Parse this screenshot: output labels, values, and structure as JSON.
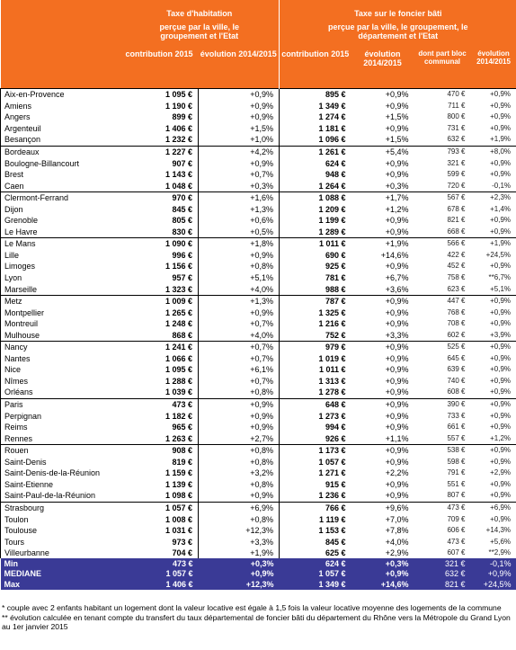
{
  "header": {
    "th_title": "Taxe d'habitation",
    "tf_title": "Taxe sur le foncier bâti",
    "th_sub": "perçue par la ville, le groupement et l'Etat",
    "tf_sub": "perçue par la ville, le groupement, le département et l'Etat",
    "columns": [
      "contribution 2015",
      "évolution 2014/2015",
      "contribution 2015",
      "évolution 2014/2015",
      "dont part bloc communal",
      "évolution 2014/2015"
    ]
  },
  "groups": [
    [
      [
        "Aix-en-Provence",
        "1 095 €",
        "+0,9%",
        "895 €",
        "+0,9%",
        "470 €",
        "+0,9%"
      ],
      [
        "Amiens",
        "1 190 €",
        "+0,9%",
        "1 349 €",
        "+0,9%",
        "711 €",
        "+0,9%"
      ],
      [
        "Angers",
        "899 €",
        "+0,9%",
        "1 274 €",
        "+1,5%",
        "800 €",
        "+0,9%"
      ],
      [
        "Argenteuil",
        "1 406 €",
        "+1,5%",
        "1 181 €",
        "+0,9%",
        "731 €",
        "+0,9%"
      ],
      [
        "Besançon",
        "1 232 €",
        "+1,0%",
        "1 096 €",
        "+1,5%",
        "632 €",
        "+1,9%"
      ]
    ],
    [
      [
        "Bordeaux",
        "1 227 €",
        "+4,2%",
        "1 261 €",
        "+5,4%",
        "793 €",
        "+8,0%"
      ],
      [
        "Boulogne-Billancourt",
        "907 €",
        "+0,9%",
        "624 €",
        "+0,9%",
        "321 €",
        "+0,9%"
      ],
      [
        "Brest",
        "1 143 €",
        "+0,7%",
        "948 €",
        "+0,9%",
        "599 €",
        "+0,9%"
      ],
      [
        "Caen",
        "1 048 €",
        "+0,3%",
        "1 264 €",
        "+0,3%",
        "720 €",
        "-0,1%"
      ]
    ],
    [
      [
        "Clermont-Ferrand",
        "970 €",
        "+1,6%",
        "1 088 €",
        "+1,7%",
        "567 €",
        "+2,3%"
      ],
      [
        "Dijon",
        "845 €",
        "+1,3%",
        "1 209 €",
        "+1,2%",
        "678 €",
        "+1,4%"
      ],
      [
        "Grenoble",
        "805 €",
        "+0,6%",
        "1 199 €",
        "+0,9%",
        "821 €",
        "+0,9%"
      ],
      [
        "Le Havre",
        "830 €",
        "+0,5%",
        "1 289 €",
        "+0,9%",
        "668 €",
        "+0,9%"
      ]
    ],
    [
      [
        "Le Mans",
        "1 090 €",
        "+1,8%",
        "1 011 €",
        "+1,9%",
        "566 €",
        "+1,9%"
      ],
      [
        "Lille",
        "996 €",
        "+0,9%",
        "690 €",
        "+14,6%",
        "422 €",
        "+24,5%"
      ],
      [
        "Limoges",
        "1 156 €",
        "+0,8%",
        "925 €",
        "+0,9%",
        "452 €",
        "+0,9%"
      ],
      [
        "Lyon",
        "957 €",
        "+5,1%",
        "781 €",
        "+6,7%",
        "758 €",
        "**6,7%"
      ],
      [
        "Marseille",
        "1 323 €",
        "+4,0%",
        "988 €",
        "+3,6%",
        "623 €",
        "+5,1%"
      ]
    ],
    [
      [
        "Metz",
        "1 009 €",
        "+1,3%",
        "787 €",
        "+0,9%",
        "447 €",
        "+0,9%"
      ],
      [
        "Montpellier",
        "1 265 €",
        "+0,9%",
        "1 325 €",
        "+0,9%",
        "768 €",
        "+0,9%"
      ],
      [
        "Montreuil",
        "1 248 €",
        "+0,7%",
        "1 216 €",
        "+0,9%",
        "708 €",
        "+0,9%"
      ],
      [
        "Mulhouse",
        "868 €",
        "+4,0%",
        "752 €",
        "+3,3%",
        "602 €",
        "+3,9%"
      ]
    ],
    [
      [
        "Nancy",
        "1 241 €",
        "+0,7%",
        "979 €",
        "+0,9%",
        "525 €",
        "+0,9%"
      ],
      [
        "Nantes",
        "1 066 €",
        "+0,7%",
        "1 019 €",
        "+0,9%",
        "645 €",
        "+0,9%"
      ],
      [
        "Nice",
        "1 095 €",
        "+6,1%",
        "1 011 €",
        "+0,9%",
        "639 €",
        "+0,9%"
      ],
      [
        "Nîmes",
        "1 288 €",
        "+0,7%",
        "1 313 €",
        "+0,9%",
        "740 €",
        "+0,9%"
      ],
      [
        "Orléans",
        "1 039 €",
        "+0,8%",
        "1 278 €",
        "+0,9%",
        "608 €",
        "+0,9%"
      ]
    ],
    [
      [
        "Paris",
        "473 €",
        "+0,9%",
        "648 €",
        "+0,9%",
        "390 €",
        "+0,9%"
      ],
      [
        "Perpignan",
        "1 182 €",
        "+0,9%",
        "1 273 €",
        "+0,9%",
        "733 €",
        "+0,9%"
      ],
      [
        "Reims",
        "965 €",
        "+0,9%",
        "994 €",
        "+0,9%",
        "661 €",
        "+0,9%"
      ],
      [
        "Rennes",
        "1 263 €",
        "+2,7%",
        "926 €",
        "+1,1%",
        "557 €",
        "+1,2%"
      ]
    ],
    [
      [
        "Rouen",
        "908 €",
        "+0,8%",
        "1 173 €",
        "+0,9%",
        "538 €",
        "+0,9%"
      ],
      [
        "Saint-Denis",
        "819 €",
        "+0,8%",
        "1 057 €",
        "+0,9%",
        "598 €",
        "+0,9%"
      ],
      [
        "Saint-Denis-de-la-Réunion",
        "1 159 €",
        "+3,2%",
        "1 271 €",
        "+2,2%",
        "791 €",
        "+2,9%"
      ],
      [
        "Saint-Etienne",
        "1 139 €",
        "+0,8%",
        "915 €",
        "+0,9%",
        "551 €",
        "+0,9%"
      ],
      [
        "Saint-Paul-de-la-Réunion",
        "1 098 €",
        "+0,9%",
        "1 236 €",
        "+0,9%",
        "807 €",
        "+0,9%"
      ]
    ],
    [
      [
        "Strasbourg",
        "1 057 €",
        "+6,9%",
        "766 €",
        "+9,6%",
        "473 €",
        "+6,9%"
      ],
      [
        "Toulon",
        "1 008 €",
        "+0,8%",
        "1 119 €",
        "+7,0%",
        "709 €",
        "+0,9%"
      ],
      [
        "Toulouse",
        "1 031 €",
        "+12,3%",
        "1 153 €",
        "+7,8%",
        "606 €",
        "+14,3%"
      ],
      [
        "Tours",
        "973 €",
        "+3,3%",
        "845 €",
        "+4,0%",
        "473 €",
        "+5,6%"
      ],
      [
        "Villeurbanne",
        "704 €",
        "+1,9%",
        "625 €",
        "+2,9%",
        "607 €",
        "**2,9%"
      ]
    ]
  ],
  "summary": [
    [
      "Min",
      "473 €",
      "+0,3%",
      "624 €",
      "+0,3%",
      "321 €",
      "-0,1%"
    ],
    [
      "MEDIANE",
      "1 057 €",
      "+0,9%",
      "1 057 €",
      "+0,9%",
      "632 €",
      "+0,9%"
    ],
    [
      "Max",
      "1 406 €",
      "+12,3%",
      "1 349 €",
      "+14,6%",
      "821 €",
      "+24,5%"
    ]
  ],
  "notes": [
    "* couple avec 2 enfants habitant un logement dont la valeur locative est égale à 1,5 fois la valeur locative moyenne des logements de la commune",
    "** évolution calculée en tenant compte du transfert du taux départemental de foncier bâti du département du Rhône vers la Métropole du Grand Lyon au 1er janvier 2015"
  ]
}
